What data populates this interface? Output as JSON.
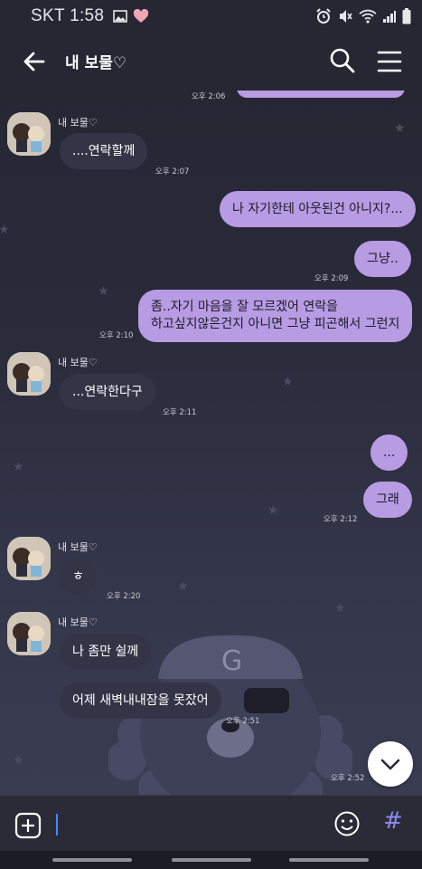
{
  "status_bar": {
    "carrier_time": "SKT 1:58",
    "icons": [
      "image-icon",
      "heart-icon",
      "alarm-icon",
      "mute-icon",
      "wifi-icon",
      "signal-icon",
      "battery-icon"
    ]
  },
  "header": {
    "title": "내 보물♡",
    "icons": [
      "back-arrow-icon",
      "search-icon",
      "menu-icon"
    ]
  },
  "sender_name": "내 보물♡",
  "messages": [
    {
      "side": "in",
      "text": "....연락할께",
      "time": "오후 2:07"
    },
    {
      "side": "out",
      "text": "나 자기한테 아웃된건 아니지?...",
      "time": ""
    },
    {
      "side": "out",
      "text": "그냥..",
      "time": "오후 2:09"
    },
    {
      "side": "out",
      "text": "좀..자기 마음을 잘 모르겠어 연락을",
      "text2": "하고싶지않은건지 아니면 그냥 피곤해서 그런지",
      "time": "오후 2:10"
    },
    {
      "side": "in",
      "text": "...연락한다구",
      "time": "오후 2:11"
    },
    {
      "side": "out",
      "text": "...",
      "time": ""
    },
    {
      "side": "out",
      "text": "그래",
      "time": "오후 2:12"
    },
    {
      "side": "in",
      "text": "ㅎ",
      "time": "오후 2:20"
    },
    {
      "side": "in",
      "text": "나 좀만 쉴께",
      "time": ""
    },
    {
      "side": "in",
      "text": "어제 새벽내내잠을 못잤어",
      "time": "오후 2:51"
    },
    {
      "side": "none",
      "text": "",
      "time": "오후 2:52"
    }
  ],
  "top_partial_time": "오후 2:06",
  "colors": {
    "outgoing_bubble": "#b79be3",
    "incoming_bubble": "#333546",
    "background": "#262733",
    "accent": "#8a8df0"
  }
}
